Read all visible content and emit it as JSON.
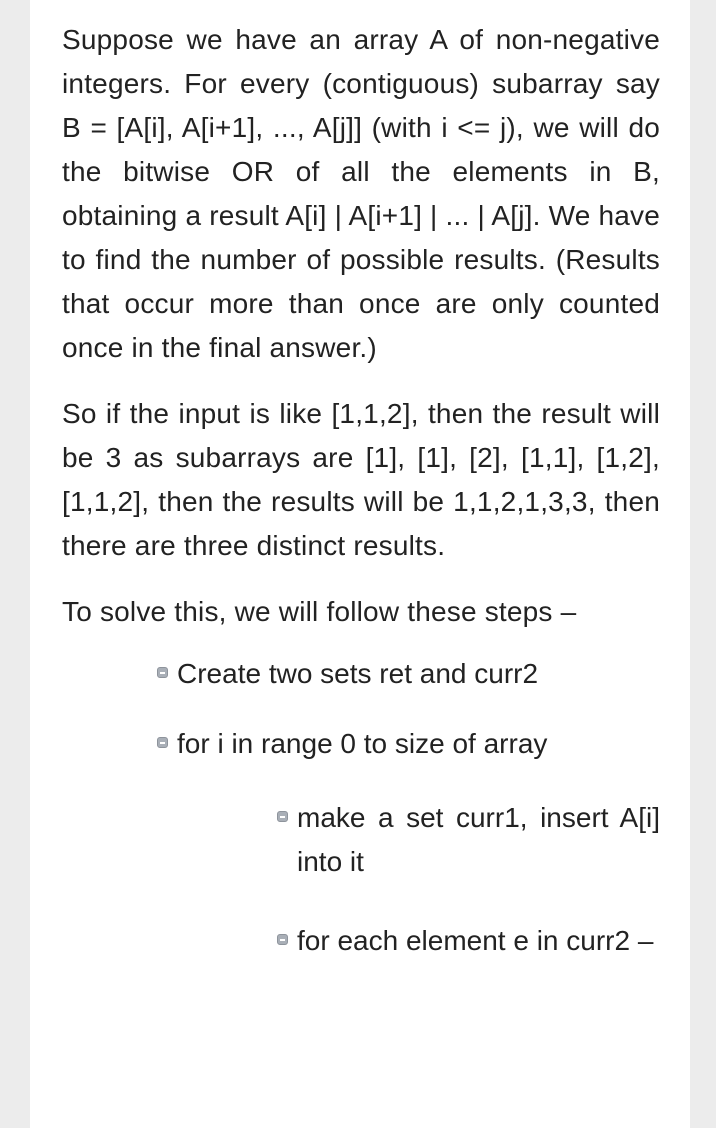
{
  "paragraphs": [
    "Suppose we have an array A of non-negative integers. For every (contiguous) subarray say B = [A[i], A[i+1], ..., A[j]] (with i <= j), we will do the bitwise OR of all the elements in B, obtaining a result A[i] | A[i+1] | ... | A[j]. We have to find the number of possible results. (Results that occur more than once are only counted once in the final answer.)",
    "So if the input is like [1,1,2], then the result will be 3 as subarrays are [1], [1], [2], [1,1], [1,2], [1,1,2], then the results will be 1,1,2,1,3,3, then there are three distinct results.",
    "To solve this, we will follow these steps –"
  ],
  "steps": [
    {
      "text": "Create two sets ret and curr2",
      "level": 1
    },
    {
      "text": "for i in range 0 to size of array",
      "level": 1
    },
    {
      "text": "make a set curr1, insert A[i] into it",
      "level": 2
    },
    {
      "text": "for each element e in curr2 –",
      "level": 2
    }
  ],
  "colors": {
    "text": "#222222",
    "page_background": "#ffffff",
    "outer_background": "#ececec",
    "bullet": "#a9afb7"
  },
  "icons": {
    "bullet": "list-bullet-icon"
  }
}
